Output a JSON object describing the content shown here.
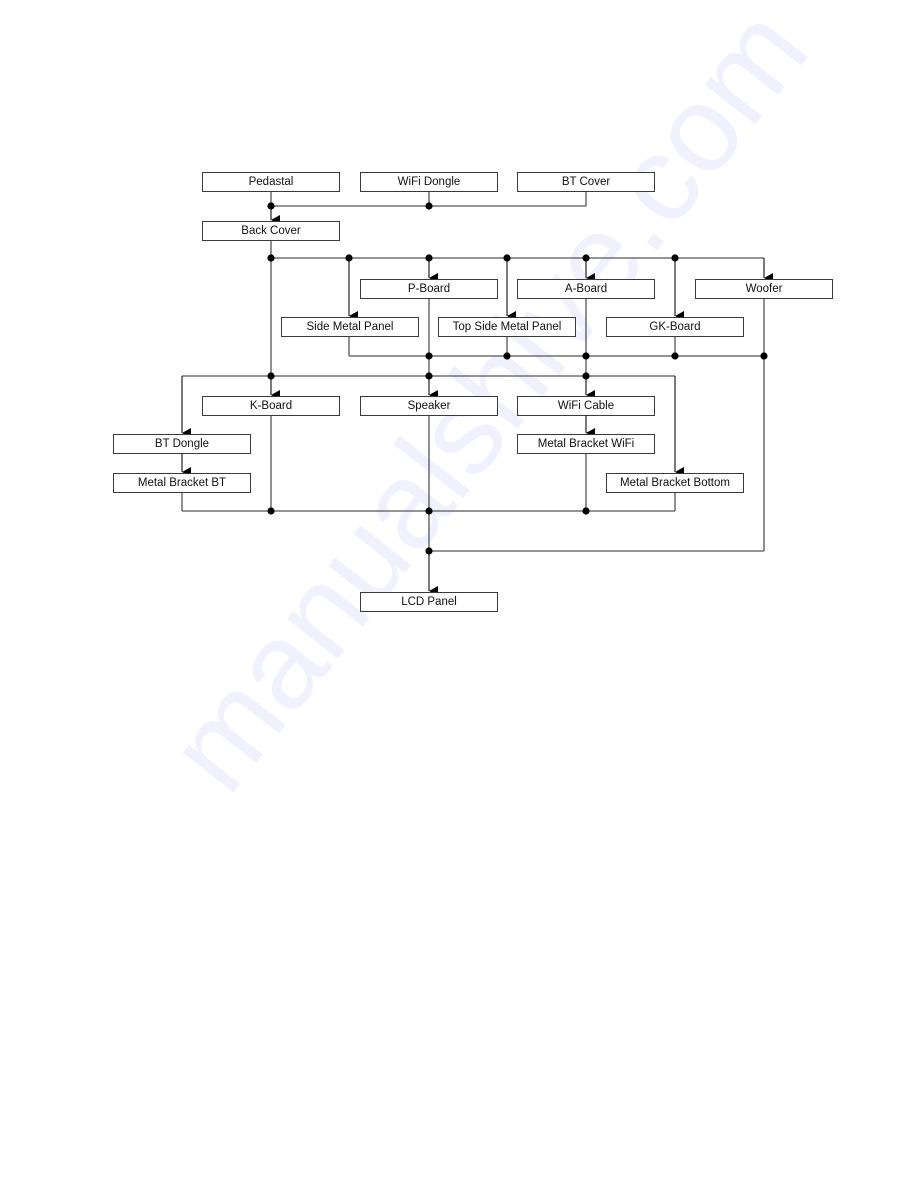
{
  "diagram": {
    "type": "disassembly-flowchart",
    "watermark": "manualshive.com",
    "nodes": [
      {
        "id": "pedastal",
        "label": "Pedastal"
      },
      {
        "id": "wifi-dongle",
        "label": "WiFi Dongle"
      },
      {
        "id": "bt-cover",
        "label": "BT Cover"
      },
      {
        "id": "back-cover",
        "label": "Back Cover"
      },
      {
        "id": "p-board",
        "label": "P-Board"
      },
      {
        "id": "a-board",
        "label": "A-Board"
      },
      {
        "id": "woofer",
        "label": "Woofer"
      },
      {
        "id": "side-metal-panel",
        "label": "Side Metal Panel"
      },
      {
        "id": "top-side-metal-panel",
        "label": "Top Side Metal Panel"
      },
      {
        "id": "gk-board",
        "label": "GK-Board"
      },
      {
        "id": "k-board",
        "label": "K-Board"
      },
      {
        "id": "speaker",
        "label": "Speaker"
      },
      {
        "id": "wifi-cable",
        "label": "WiFi Cable"
      },
      {
        "id": "bt-dongle",
        "label": "BT Dongle"
      },
      {
        "id": "metal-bracket-wifi",
        "label": "Metal Bracket WiFi"
      },
      {
        "id": "metal-bracket-bt",
        "label": "Metal Bracket BT"
      },
      {
        "id": "metal-bracket-bottom",
        "label": "Metal Bracket Bottom"
      },
      {
        "id": "lcd-panel",
        "label": "LCD Panel"
      }
    ],
    "edges": [
      {
        "from": [
          "pedastal",
          "wifi-dongle",
          "bt-cover"
        ],
        "to": "back-cover"
      },
      {
        "from": [
          "back-cover"
        ],
        "to": "side-metal-panel"
      },
      {
        "from": [
          "back-cover"
        ],
        "to": "p-board"
      },
      {
        "from": [
          "back-cover"
        ],
        "to": "top-side-metal-panel"
      },
      {
        "from": [
          "back-cover"
        ],
        "to": "a-board"
      },
      {
        "from": [
          "back-cover"
        ],
        "to": "gk-board"
      },
      {
        "from": [
          "back-cover"
        ],
        "to": "woofer"
      },
      {
        "from": [
          "back-cover",
          "side-metal-panel",
          "p-board",
          "top-side-metal-panel",
          "a-board",
          "gk-board"
        ],
        "to": "bt-dongle"
      },
      {
        "from": [
          "back-cover",
          "side-metal-panel",
          "p-board",
          "top-side-metal-panel",
          "a-board",
          "gk-board"
        ],
        "to": "k-board"
      },
      {
        "from": [
          "back-cover",
          "side-metal-panel",
          "p-board",
          "top-side-metal-panel",
          "a-board",
          "gk-board"
        ],
        "to": "speaker"
      },
      {
        "from": [
          "back-cover",
          "side-metal-panel",
          "p-board",
          "top-side-metal-panel",
          "a-board",
          "gk-board"
        ],
        "to": "wifi-cable"
      },
      {
        "from": [
          "back-cover",
          "side-metal-panel",
          "p-board",
          "top-side-metal-panel",
          "a-board",
          "gk-board"
        ],
        "to": "metal-bracket-bottom"
      },
      {
        "from": [
          "bt-dongle"
        ],
        "to": "metal-bracket-bt"
      },
      {
        "from": [
          "wifi-cable"
        ],
        "to": "metal-bracket-wifi"
      },
      {
        "from": [
          "metal-bracket-bt",
          "k-board",
          "speaker",
          "metal-bracket-wifi",
          "metal-bracket-bottom",
          "woofer"
        ],
        "to": "lcd-panel"
      }
    ]
  }
}
